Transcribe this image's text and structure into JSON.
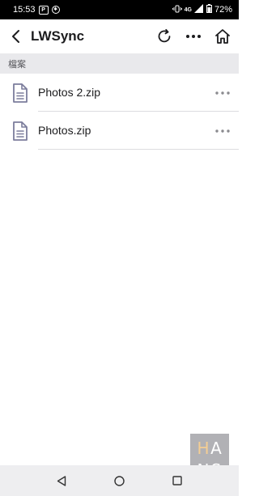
{
  "status_bar": {
    "time": "15:53",
    "badge_label": "P",
    "net_label": "4G",
    "battery": "72%"
  },
  "header": {
    "title": "LWSync"
  },
  "section": {
    "label": "檔案"
  },
  "files": [
    {
      "name": "Photos 2.zip"
    },
    {
      "name": "Photos.zip"
    }
  ],
  "watermark": {
    "letters": [
      "H",
      "A",
      "N",
      "S"
    ]
  },
  "icons": {
    "back": "chevron-left-icon",
    "refresh": "refresh-icon",
    "more": "more-horizontal-icon",
    "home": "home-icon",
    "file": "document-icon"
  },
  "colors": {
    "section_bg": "#e9e9ec",
    "icon": "#7c7d9c",
    "text": "#1c1c1e"
  }
}
